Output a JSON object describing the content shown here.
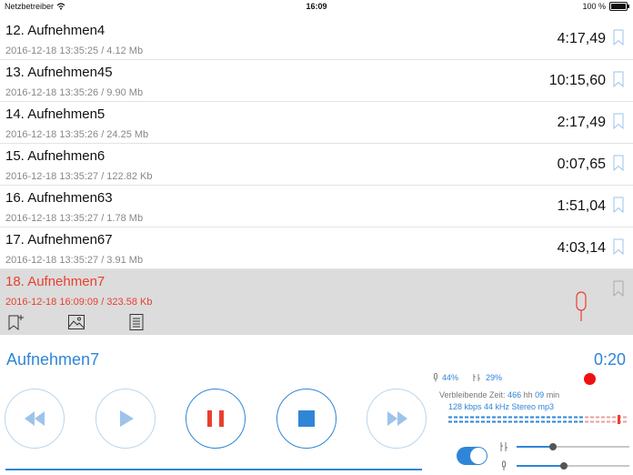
{
  "status_bar": {
    "carrier": "Netzbetreiber",
    "time": "16:09",
    "battery": "100 %",
    "battery_level": 1.0
  },
  "recordings": [
    {
      "title": "12. Aufnehmen4",
      "meta": "2016-12-18 13:35:25 / 4.12 Mb",
      "duration": "4:17,49"
    },
    {
      "title": "13. Aufnehmen45",
      "meta": "2016-12-18 13:35:26 / 9.90 Mb",
      "duration": "10:15,60"
    },
    {
      "title": "14. Aufnehmen5",
      "meta": "2016-12-18 13:35:26 / 24.25 Mb",
      "duration": "2:17,49"
    },
    {
      "title": "15. Aufnehmen6",
      "meta": "2016-12-18 13:35:27 / 122.82 Kb",
      "duration": "0:07,65"
    },
    {
      "title": "16. Aufnehmen63",
      "meta": "2016-12-18 13:35:27 / 1.78 Mb",
      "duration": "1:51,04"
    },
    {
      "title": "17. Aufnehmen67",
      "meta": "2016-12-18 13:35:27 / 3.91 Mb",
      "duration": "4:03,14"
    }
  ],
  "selected_recording": {
    "title": "18. Aufnehmen7",
    "meta": "2016-12-18 16:09:09 / 323.58 Kb"
  },
  "player": {
    "title": "Aufnehmen7",
    "time": "0:20",
    "mic_level": "44%",
    "gain_level": "29%",
    "remaining_prefix": "Verbleibende Zeit:",
    "remaining_hours": "466",
    "remaining_hours_unit": "hh",
    "remaining_minutes": "09",
    "remaining_minutes_unit": "min",
    "format": "128 kbps 44 kHz Stereo mp3",
    "monitor_toggle_on": true,
    "slider_gain": 0.32,
    "slider_volume": 0.42
  },
  "colors": {
    "accent": "#2f86d6",
    "recording": "#e8402f",
    "record_dot": "#f01010",
    "selected_bg": "#dcdcdc"
  }
}
